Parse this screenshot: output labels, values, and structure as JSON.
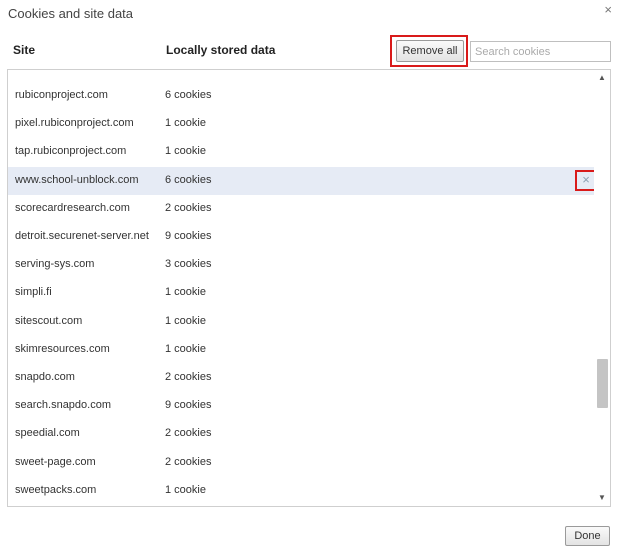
{
  "dialog": {
    "title": "Cookies and site data",
    "close_glyph": "×"
  },
  "header": {
    "site_label": "Site",
    "data_label": "Locally stored data",
    "remove_all_label": "Remove all",
    "search_placeholder": "Search cookies"
  },
  "rows": [
    {
      "site": "rubiconproject.com",
      "data": "6 cookies"
    },
    {
      "site": "pixel.rubiconproject.com",
      "data": "1 cookie"
    },
    {
      "site": "tap.rubiconproject.com",
      "data": "1 cookie"
    },
    {
      "site": "www.school-unblock.com",
      "data": "6 cookies",
      "selected": true
    },
    {
      "site": "scorecardresearch.com",
      "data": "2 cookies"
    },
    {
      "site": "detroit.securenet-server.net",
      "data": "9 cookies"
    },
    {
      "site": "serving-sys.com",
      "data": "3 cookies"
    },
    {
      "site": "simpli.fi",
      "data": "1 cookie"
    },
    {
      "site": "sitescout.com",
      "data": "1 cookie"
    },
    {
      "site": "skimresources.com",
      "data": "1 cookie"
    },
    {
      "site": "snapdo.com",
      "data": "2 cookies"
    },
    {
      "site": "search.snapdo.com",
      "data": "9 cookies"
    },
    {
      "site": "speedial.com",
      "data": "2 cookies"
    },
    {
      "site": "sweet-page.com",
      "data": "2 cookies"
    },
    {
      "site": "sweetpacks.com",
      "data": "1 cookie"
    }
  ],
  "delete_glyph": "×",
  "scrollbar": {
    "up_glyph": "▲",
    "down_glyph": "▼"
  },
  "footer": {
    "done_label": "Done"
  },
  "colors": {
    "highlight": "#d91a1a",
    "selected_row": "#e6ebf5"
  }
}
